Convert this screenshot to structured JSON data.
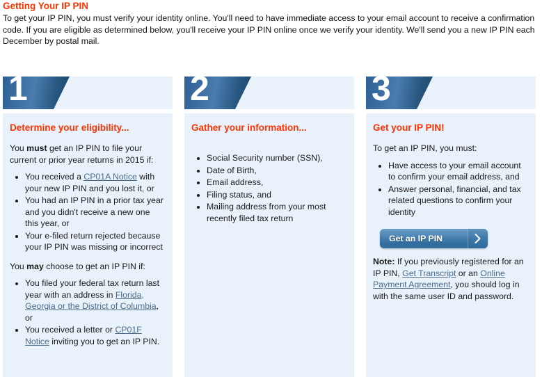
{
  "intro": {
    "title": "Getting Your IP PIN",
    "body": "To get your IP PIN, you must verify your identity online. You'll need to have immediate access to your email account to receive a confirmation code. If you are eligible as determined below, you'll receive your IP PIN online once we verify your identity. We'll send you a new IP PIN each December by postal mail."
  },
  "colors": {
    "heading": "#ff3300",
    "panel_bg": "#e9f2fb",
    "badge_blue": "#2e6094",
    "link": "#4a6b8a",
    "button_blue": "#3f7aa9"
  },
  "steps": [
    {
      "number": "1",
      "title": "Determine your eligibility...",
      "must_intro_pre": "You ",
      "must_intro_bold": "must",
      "must_intro_post": " get an IP PIN to file your current or prior year returns in 2015 if:",
      "must_items": [
        {
          "pre": "You received a ",
          "link": "CP01A Notice",
          "post": " with your new IP PIN and you lost it, or"
        },
        {
          "pre": "You had an IP PIN in a prior tax year and you didn't receive a new one this year, or",
          "link": "",
          "post": ""
        },
        {
          "pre": "Your e-filed return rejected because your IP PIN was missing or incorrect",
          "link": "",
          "post": ""
        }
      ],
      "may_intro_pre": "You ",
      "may_intro_bold": "may",
      "may_intro_post": " choose to get an IP PIN if:",
      "may_items": [
        {
          "pre": "You filed your federal tax return last year with an address in ",
          "link": "Florida, Georgia or the District of Columbia",
          "post": ", or"
        },
        {
          "pre": "You received a letter or ",
          "link": "CP01F Notice",
          "post": " inviting you to get an IP PIN."
        }
      ]
    },
    {
      "number": "2",
      "title": "Gather your information...",
      "items": [
        "Social Security number (SSN),",
        "Date of Birth,",
        "Email address,",
        "Filing status, and",
        "Mailing address from your most recently filed tax return"
      ]
    },
    {
      "number": "3",
      "title": "Get your IP PIN!",
      "intro": "To get an IP PIN, you must:",
      "items": [
        "Have access to your email account to confirm your email address, and",
        "Answer personal, financial, and tax related questions to confirm your identity"
      ],
      "button": {
        "label": "Get an IP PIN",
        "arrow_icon": "chevron-right-icon"
      },
      "note": {
        "label": "Note:",
        "part1": " If you previously registered for an IP PIN, ",
        "link1": "Get Transcript",
        "part2": " or an ",
        "link2": "Online Payment Agreement",
        "part3": ", you should log in with the same user ID and password."
      }
    }
  ]
}
